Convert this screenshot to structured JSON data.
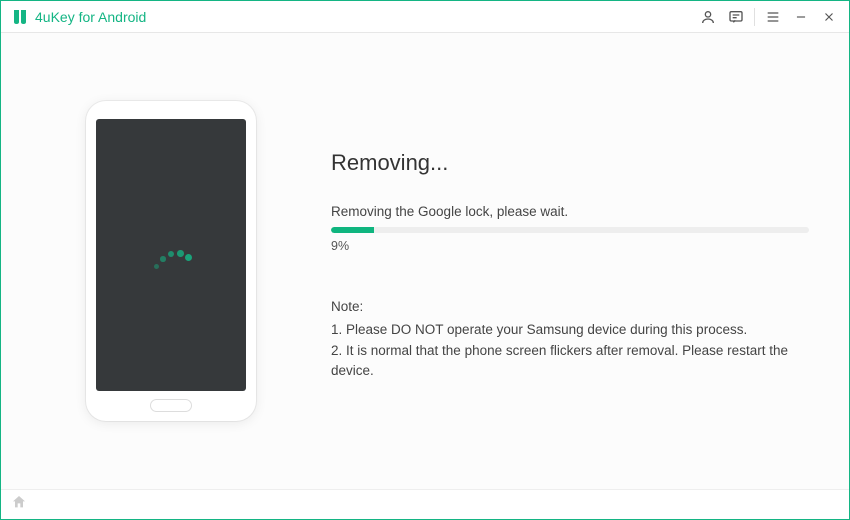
{
  "titlebar": {
    "app_name": "4uKey for Android"
  },
  "main": {
    "heading": "Removing...",
    "status": "Removing the Google lock, please wait.",
    "progress_percent": 9,
    "percent_label": "9%"
  },
  "notes": {
    "title": "Note:",
    "item1": "1. Please DO NOT operate your Samsung device during this process.",
    "item2": "2. It is normal that the phone screen flickers after removal. Please restart the device."
  },
  "colors": {
    "accent": "#14b584"
  }
}
